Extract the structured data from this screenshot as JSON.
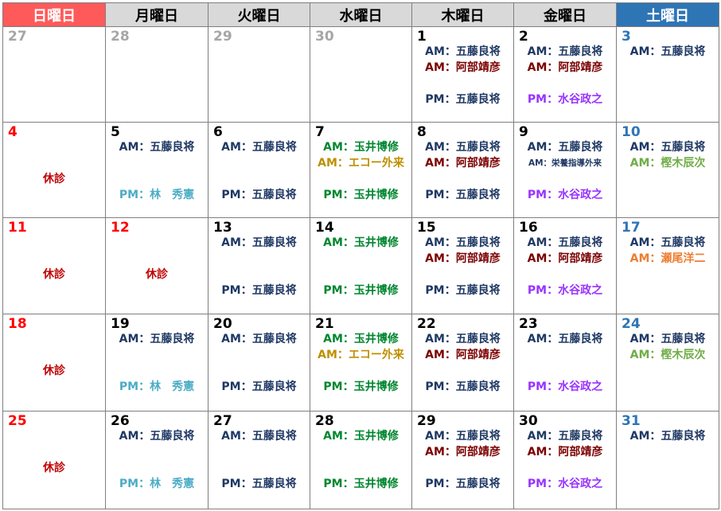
{
  "colors": {
    "navy": "#1f3864",
    "maroon": "#7b0000",
    "purple": "#9933ff",
    "green": "#00862f",
    "gold": "#bf8f00",
    "teal": "#4bacc6",
    "olive": "#70ad47",
    "orange": "#ed7d31",
    "closed": "#c00000"
  },
  "headers": [
    "日曜日",
    "月曜日",
    "火曜日",
    "水曜日",
    "木曜日",
    "金曜日",
    "土曜日"
  ],
  "weeks": [
    [
      {
        "day": "27",
        "kind": "other",
        "lines": []
      },
      {
        "day": "28",
        "kind": "other",
        "lines": []
      },
      {
        "day": "29",
        "kind": "other",
        "lines": []
      },
      {
        "day": "30",
        "kind": "other",
        "lines": []
      },
      {
        "day": "1",
        "kind": "normal",
        "lines": [
          {
            "slot": 0,
            "text": "AM：五藤良将",
            "color": "navy"
          },
          {
            "slot": 1,
            "text": "AM：阿部靖彦",
            "color": "maroon"
          },
          {
            "slot": 3,
            "text": "PM：五藤良将",
            "color": "navy"
          }
        ]
      },
      {
        "day": "2",
        "kind": "normal",
        "lines": [
          {
            "slot": 0,
            "text": "AM：五藤良将",
            "color": "navy"
          },
          {
            "slot": 1,
            "text": "AM：阿部靖彦",
            "color": "maroon"
          },
          {
            "slot": 3,
            "text": "PM：水谷政之",
            "color": "purple"
          }
        ]
      },
      {
        "day": "3",
        "kind": "sat",
        "lines": [
          {
            "slot": 0,
            "text": "AM：五藤良将",
            "color": "navy"
          }
        ]
      }
    ],
    [
      {
        "day": "4",
        "kind": "sun",
        "closed": "休診",
        "lines": []
      },
      {
        "day": "5",
        "kind": "normal",
        "lines": [
          {
            "slot": 0,
            "text": "AM：五藤良将",
            "color": "navy"
          },
          {
            "slot": 3,
            "text": "PM：林　秀憲",
            "color": "teal"
          }
        ]
      },
      {
        "day": "6",
        "kind": "normal",
        "lines": [
          {
            "slot": 0,
            "text": "AM：五藤良将",
            "color": "navy"
          },
          {
            "slot": 3,
            "text": "PM：五藤良将",
            "color": "navy"
          }
        ]
      },
      {
        "day": "7",
        "kind": "normal",
        "lines": [
          {
            "slot": 0,
            "text": "AM：玉井博修",
            "color": "green"
          },
          {
            "slot": 1,
            "text": "AM：エコー外来",
            "color": "gold"
          },
          {
            "slot": 3,
            "text": "PM：玉井博修",
            "color": "green"
          }
        ]
      },
      {
        "day": "8",
        "kind": "normal",
        "lines": [
          {
            "slot": 0,
            "text": "AM：五藤良将",
            "color": "navy"
          },
          {
            "slot": 1,
            "text": "AM：阿部靖彦",
            "color": "maroon"
          },
          {
            "slot": 3,
            "text": "PM：五藤良将",
            "color": "navy"
          }
        ]
      },
      {
        "day": "9",
        "kind": "normal",
        "lines": [
          {
            "slot": 0,
            "text": "AM：五藤良将",
            "color": "navy"
          },
          {
            "slot": 1,
            "text": "AM：栄養指導外来",
            "color": "navy",
            "small": true
          },
          {
            "slot": 3,
            "text": "PM：水谷政之",
            "color": "purple"
          }
        ]
      },
      {
        "day": "10",
        "kind": "sat",
        "lines": [
          {
            "slot": 0,
            "text": "AM：五藤良将",
            "color": "navy"
          },
          {
            "slot": 1,
            "text": "AM：樫木辰次",
            "color": "olive"
          }
        ]
      }
    ],
    [
      {
        "day": "11",
        "kind": "sun",
        "closed": "休診",
        "lines": []
      },
      {
        "day": "12",
        "kind": "sun",
        "closed": "休診",
        "lines": []
      },
      {
        "day": "13",
        "kind": "normal",
        "lines": [
          {
            "slot": 0,
            "text": "AM：五藤良将",
            "color": "navy"
          },
          {
            "slot": 3,
            "text": "PM：五藤良将",
            "color": "navy"
          }
        ]
      },
      {
        "day": "14",
        "kind": "normal",
        "lines": [
          {
            "slot": 0,
            "text": "AM：玉井博修",
            "color": "green"
          },
          {
            "slot": 3,
            "text": "PM：玉井博修",
            "color": "green"
          }
        ]
      },
      {
        "day": "15",
        "kind": "normal",
        "lines": [
          {
            "slot": 0,
            "text": "AM：五藤良将",
            "color": "navy"
          },
          {
            "slot": 1,
            "text": "AM：阿部靖彦",
            "color": "maroon"
          },
          {
            "slot": 3,
            "text": "PM：五藤良将",
            "color": "navy"
          }
        ]
      },
      {
        "day": "16",
        "kind": "normal",
        "lines": [
          {
            "slot": 0,
            "text": "AM：五藤良将",
            "color": "navy"
          },
          {
            "slot": 1,
            "text": "AM：阿部靖彦",
            "color": "maroon"
          },
          {
            "slot": 3,
            "text": "PM：水谷政之",
            "color": "purple"
          }
        ]
      },
      {
        "day": "17",
        "kind": "sat",
        "lines": [
          {
            "slot": 0,
            "text": "AM：五藤良将",
            "color": "navy"
          },
          {
            "slot": 1,
            "text": "AM：瀬尾洋二",
            "color": "orange"
          }
        ]
      }
    ],
    [
      {
        "day": "18",
        "kind": "sun",
        "closed": "休診",
        "lines": []
      },
      {
        "day": "19",
        "kind": "normal",
        "lines": [
          {
            "slot": 0,
            "text": "AM：五藤良将",
            "color": "navy"
          },
          {
            "slot": 3,
            "text": "PM：林　秀憲",
            "color": "teal"
          }
        ]
      },
      {
        "day": "20",
        "kind": "normal",
        "lines": [
          {
            "slot": 0,
            "text": "AM：五藤良将",
            "color": "navy"
          },
          {
            "slot": 3,
            "text": "PM：五藤良将",
            "color": "navy"
          }
        ]
      },
      {
        "day": "21",
        "kind": "normal",
        "lines": [
          {
            "slot": 0,
            "text": "AM：玉井博修",
            "color": "green"
          },
          {
            "slot": 1,
            "text": "AM：エコー外来",
            "color": "gold"
          },
          {
            "slot": 3,
            "text": "PM：玉井博修",
            "color": "green"
          }
        ]
      },
      {
        "day": "22",
        "kind": "normal",
        "lines": [
          {
            "slot": 0,
            "text": "AM：五藤良将",
            "color": "navy"
          },
          {
            "slot": 1,
            "text": "AM：阿部靖彦",
            "color": "maroon"
          },
          {
            "slot": 3,
            "text": "PM：五藤良将",
            "color": "navy"
          }
        ]
      },
      {
        "day": "23",
        "kind": "normal",
        "lines": [
          {
            "slot": 0,
            "text": "AM：五藤良将",
            "color": "navy"
          },
          {
            "slot": 3,
            "text": "PM：水谷政之",
            "color": "purple"
          }
        ]
      },
      {
        "day": "24",
        "kind": "sat",
        "lines": [
          {
            "slot": 0,
            "text": "AM：五藤良将",
            "color": "navy"
          },
          {
            "slot": 1,
            "text": "AM：樫木辰次",
            "color": "olive"
          }
        ]
      }
    ],
    [
      {
        "day": "25",
        "kind": "sun",
        "closed": "休診",
        "lines": []
      },
      {
        "day": "26",
        "kind": "normal",
        "lines": [
          {
            "slot": 0,
            "text": "AM：五藤良将",
            "color": "navy"
          },
          {
            "slot": 3,
            "text": "PM：林　秀憲",
            "color": "teal"
          }
        ]
      },
      {
        "day": "27",
        "kind": "normal",
        "lines": [
          {
            "slot": 0,
            "text": "AM：五藤良将",
            "color": "navy"
          },
          {
            "slot": 3,
            "text": "PM：五藤良将",
            "color": "navy"
          }
        ]
      },
      {
        "day": "28",
        "kind": "normal",
        "lines": [
          {
            "slot": 0,
            "text": "AM：玉井博修",
            "color": "green"
          },
          {
            "slot": 3,
            "text": "PM：玉井博修",
            "color": "green"
          }
        ]
      },
      {
        "day": "29",
        "kind": "normal",
        "lines": [
          {
            "slot": 0,
            "text": "AM：五藤良将",
            "color": "navy"
          },
          {
            "slot": 1,
            "text": "AM：阿部靖彦",
            "color": "maroon"
          },
          {
            "slot": 3,
            "text": "PM：五藤良将",
            "color": "navy"
          }
        ]
      },
      {
        "day": "30",
        "kind": "normal",
        "lines": [
          {
            "slot": 0,
            "text": "AM：五藤良将",
            "color": "navy"
          },
          {
            "slot": 1,
            "text": "AM：阿部靖彦",
            "color": "maroon"
          },
          {
            "slot": 3,
            "text": "PM：水谷政之",
            "color": "purple"
          }
        ]
      },
      {
        "day": "31",
        "kind": "sat",
        "lines": [
          {
            "slot": 0,
            "text": "AM：五藤良将",
            "color": "navy"
          }
        ]
      }
    ]
  ]
}
